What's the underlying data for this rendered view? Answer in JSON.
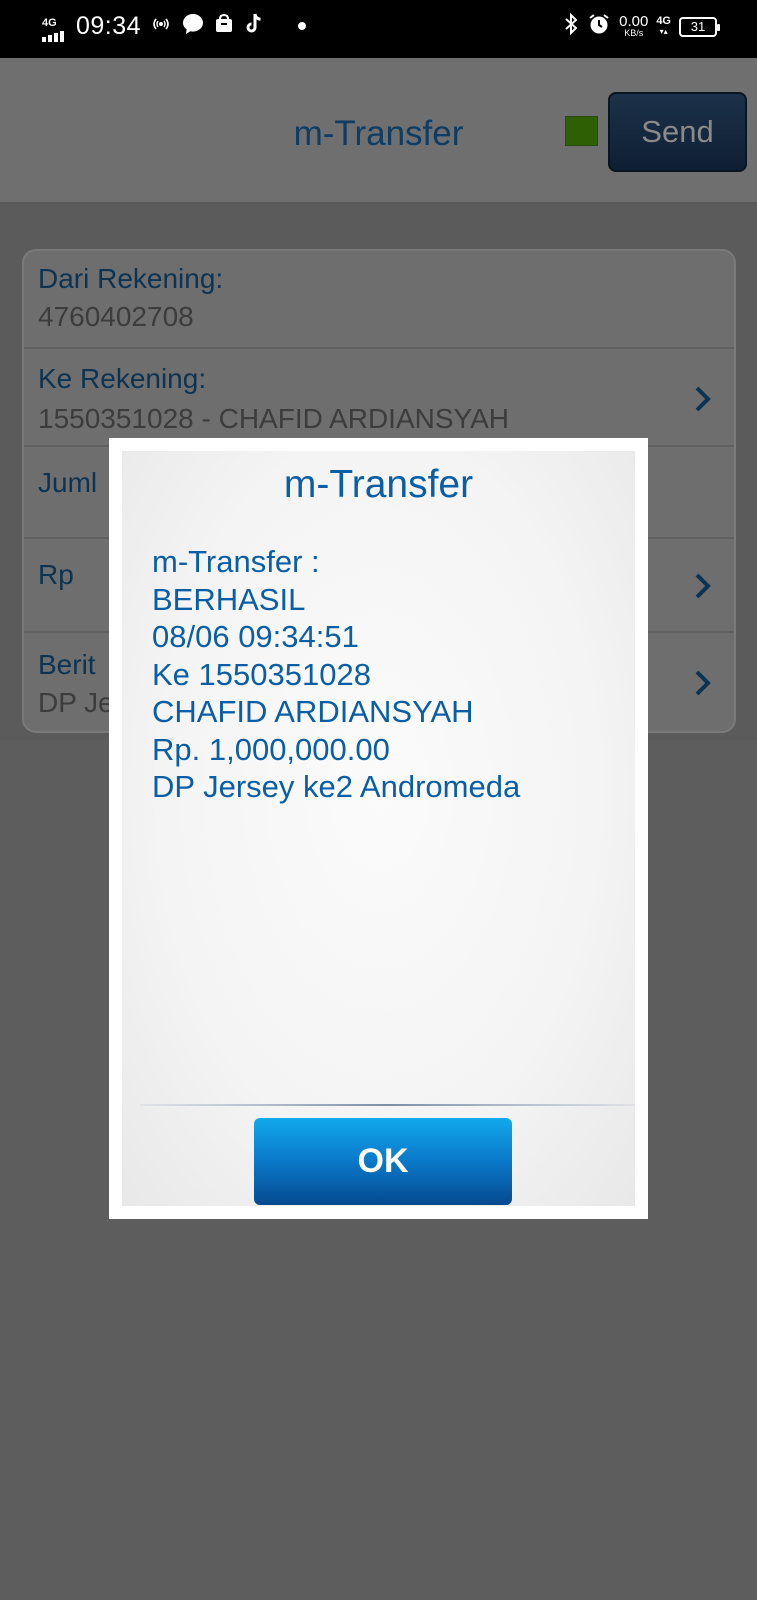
{
  "status_bar": {
    "network_left": "4G",
    "time": "09:34",
    "speed_value": "0.00",
    "speed_unit": "KB/s",
    "network_right": "4G",
    "battery": "31",
    "icons": [
      "hotspot-icon",
      "chat-icon",
      "shop-icon",
      "tiktok-icon",
      "dot-icon",
      "bluetooth-icon",
      "alarm-icon"
    ]
  },
  "header": {
    "title": "m-Transfer",
    "send_label": "Send",
    "status_color": "#2e5f05"
  },
  "form": {
    "from_label": "Dari Rekening:",
    "from_value": "4760402708",
    "to_label": "Ke Rekening:",
    "to_value": "1550351028 - CHAFID ARDIANSYAH",
    "amount_label_partial": "Juml",
    "currency_label": "Rp",
    "note_label_partial": "Berit",
    "note_value_partial": "DP Je"
  },
  "dialog": {
    "title": "m-Transfer",
    "lines": [
      "m-Transfer :",
      "BERHASIL",
      "08/06 09:34:51",
      "Ke 1550351028",
      "CHAFID ARDIANSYAH",
      "Rp. 1,000,000.00",
      "DP Jersey ke2 Andromeda"
    ],
    "ok_label": "OK"
  },
  "colors": {
    "accent_blue": "#0a5ea6",
    "ok_button": "#0a78c9"
  }
}
